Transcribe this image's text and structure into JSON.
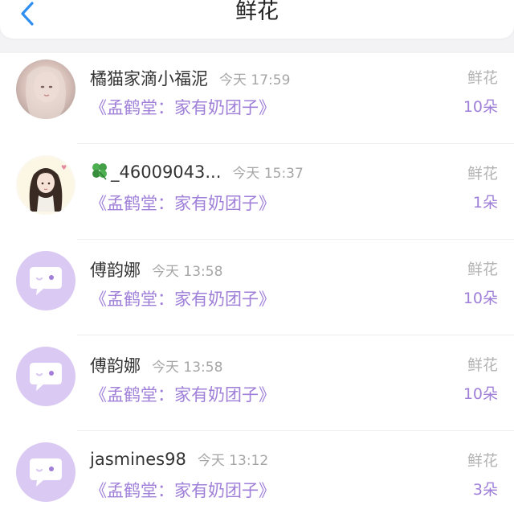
{
  "header": {
    "title": "鲜花",
    "back_icon": "chevron-left-icon",
    "accent": "#2f8ff0"
  },
  "colors": {
    "purple_text": "#9f7fd8",
    "avatar_default_bg": "#d9c9f3",
    "gray_text": "#a6a6a6"
  },
  "items": [
    {
      "username": "橘猫家滴小福泥",
      "time": "今天 17:59",
      "book": "《孟鹤堂：家有奶团子》",
      "gift_type": "鲜花",
      "count": "10朵",
      "avatar": "photo"
    },
    {
      "username": "_46009043...",
      "username_prefix_icon": "clover-icon",
      "time": "今天 15:37",
      "book": "《孟鹤堂：家有奶团子》",
      "gift_type": "鲜花",
      "count": "1朵",
      "avatar": "illustration"
    },
    {
      "username": "傅韵娜",
      "time": "今天 13:58",
      "book": "《孟鹤堂：家有奶团子》",
      "gift_type": "鲜花",
      "count": "10朵",
      "avatar": "default-chat-bubble"
    },
    {
      "username": "傅韵娜",
      "time": "今天 13:58",
      "book": "《孟鹤堂：家有奶团子》",
      "gift_type": "鲜花",
      "count": "10朵",
      "avatar": "default-chat-bubble"
    },
    {
      "username": "jasmines98",
      "time": "今天 13:12",
      "book": "《孟鹤堂：家有奶团子》",
      "gift_type": "鲜花",
      "count": "3朵",
      "avatar": "default-chat-bubble"
    }
  ]
}
